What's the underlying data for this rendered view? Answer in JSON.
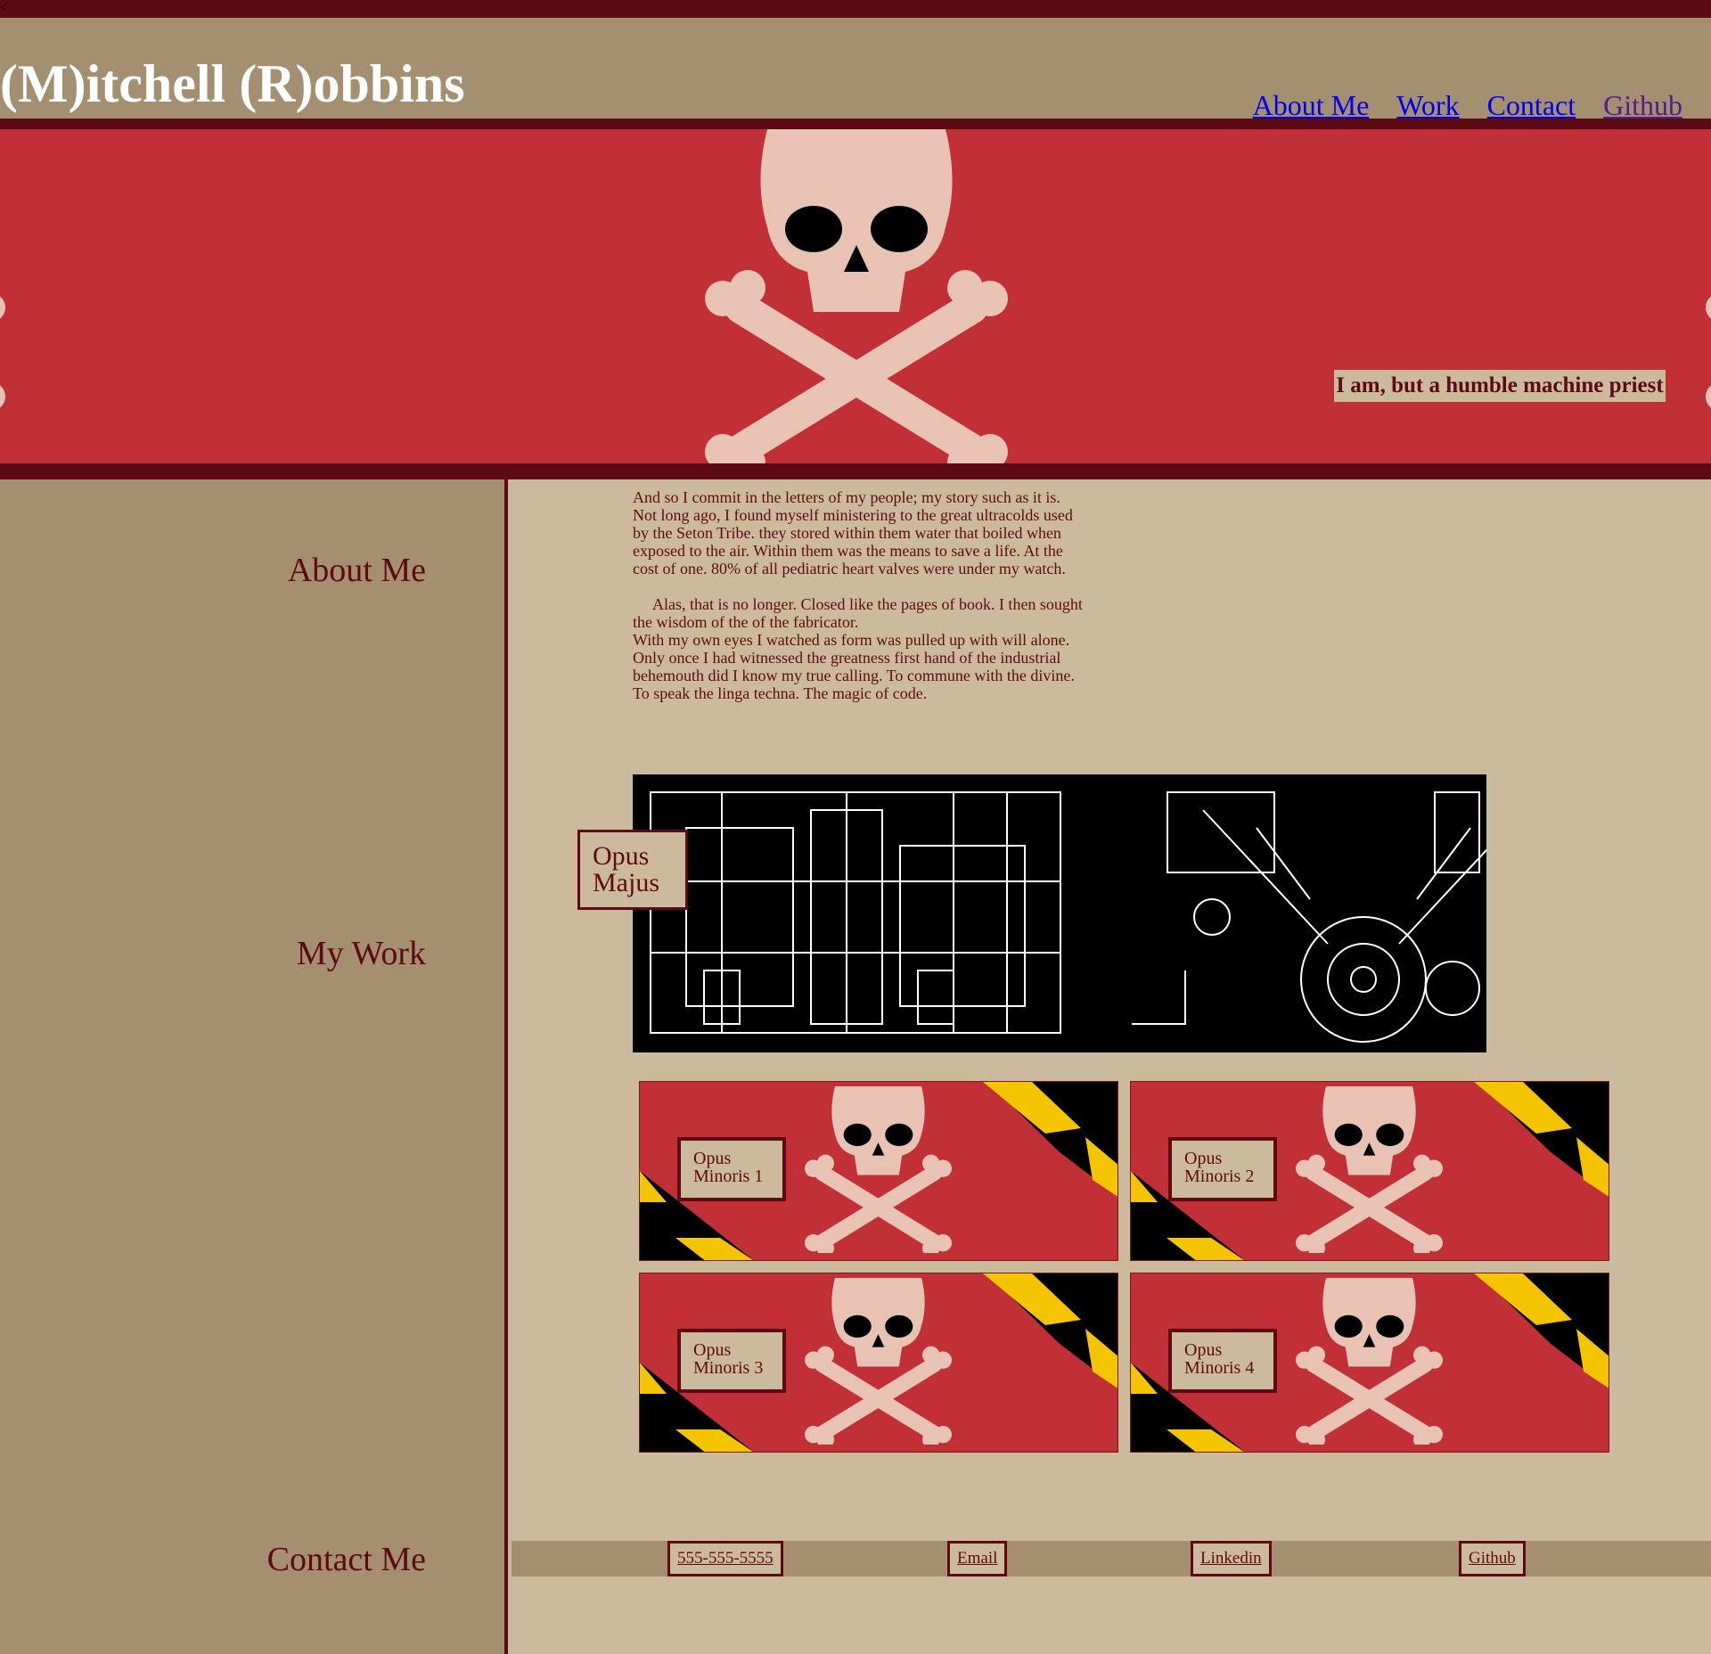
{
  "topbar": {
    "glyph": "<"
  },
  "header": {
    "title": "(M)itchell (R)obbins",
    "nav": [
      {
        "label": "About Me"
      },
      {
        "label": "Work"
      },
      {
        "label": "Contact"
      },
      {
        "label": "Github"
      }
    ]
  },
  "hero": {
    "tagline": "I am, but a humble machine priest",
    "icon": "skull-and-crossbones-icon"
  },
  "sidebar": {
    "about_heading": "About Me",
    "work_heading": "My Work",
    "contact_heading": "Contact Me"
  },
  "about": {
    "paragraph1": "And so I commit in the letters of my people; my story such as it is. Not long ago, I found myself ministering to the great ultracolds used by the Seton Tribe. they stored within them water that boiled when exposed to the air. Within them was the means to save a life. At the cost of one. 80% of all pediatric heart valves were under my watch.",
    "paragraph2a": "Alas, that is no longer. Closed like the pages of book.  I then sought the wisdom of the of the fabricator.",
    "paragraph2b": "With my own eyes I watched as form was pulled up with will alone. Only once I had witnessed the greatness first hand of the industrial behemouth did I know my true calling. To commune with the divine. To speak the linga techna. The magic of code."
  },
  "work": {
    "major": {
      "line1": "Opus",
      "line2": "Majus",
      "image": "engine-blueprint-image"
    },
    "minors": [
      {
        "line1": "Opus",
        "line2": "Minoris 1"
      },
      {
        "line1": "Opus",
        "line2": "Minoris 2"
      },
      {
        "line1": "Opus",
        "line2": "Minoris 3"
      },
      {
        "line1": "Opus",
        "line2": "Minoris 4"
      }
    ]
  },
  "contact": {
    "phone": "555-555-5555",
    "email": "Email",
    "linkedin": "Linkedin",
    "github": "Github"
  },
  "colors": {
    "maroon": "#5c0b13",
    "red": "#c03036",
    "tan": "#a58f71",
    "parchment": "#cbbb9c",
    "bone": "#e8c2b2",
    "hazard_yellow": "#f5c400",
    "link_blue": "#0000ee",
    "link_visited": "#551a8b"
  }
}
